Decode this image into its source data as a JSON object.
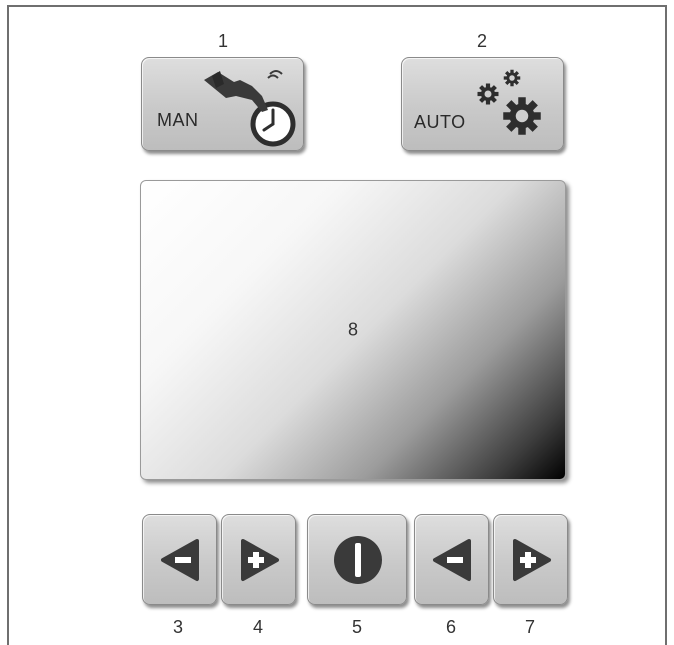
{
  "callouts": {
    "c1": "1",
    "c2": "2",
    "c3": "3",
    "c4": "4",
    "c5": "5",
    "c6": "6",
    "c7": "7",
    "c8": "8"
  },
  "buttons": {
    "manual": {
      "label": "MAN",
      "icon": "hand-clock-icon"
    },
    "auto": {
      "label": "AUTO",
      "icon": "gears-icon"
    },
    "left_minus": {
      "icon": "arrow-left-minus-icon"
    },
    "left_plus": {
      "icon": "arrow-right-plus-icon"
    },
    "power": {
      "icon": "power-icon"
    },
    "right_minus": {
      "icon": "arrow-left-minus-icon"
    },
    "right_plus": {
      "icon": "arrow-right-plus-icon"
    }
  },
  "colors": {
    "button_face": "#c9c9c9",
    "icon_dark": "#3a3a3a",
    "frame": "#6f6f6f"
  }
}
